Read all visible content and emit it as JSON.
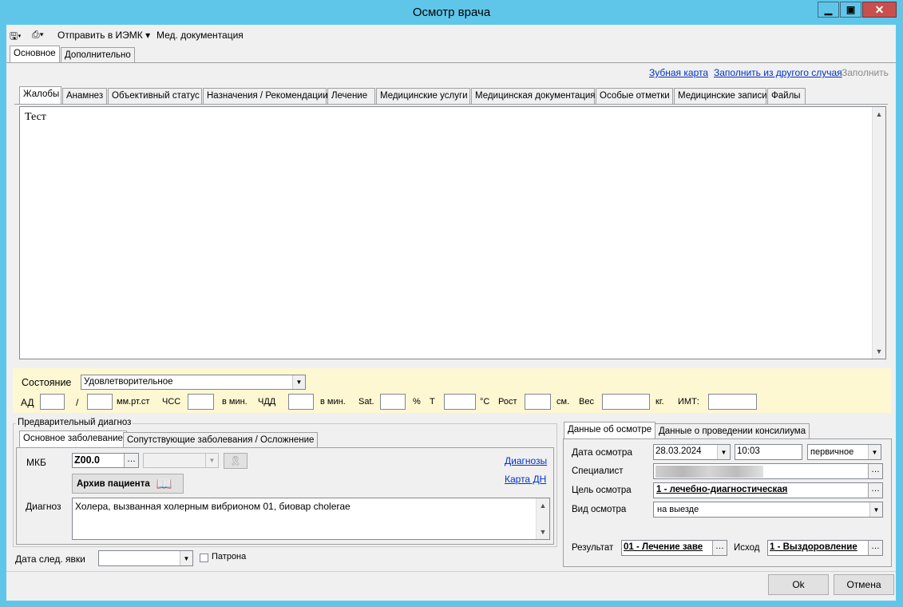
{
  "window": {
    "title": "Осмотр врача"
  },
  "toolbar": {
    "send": "Отправить в ИЭМК",
    "meddoc": "Мед. документация"
  },
  "main_tabs": [
    "Основное",
    "Дополнительно"
  ],
  "top_links": {
    "dental": "Зубная карта",
    "fill_other": "Заполнить из другого случая",
    "fill": "Заполнить"
  },
  "sub_tabs": [
    "Жалобы",
    "Анамнез",
    "Объективный статус",
    "Назначения / Рекомендации",
    "Лечение",
    "Медицинские услуги",
    "Медицинская документация",
    "Особые отметки",
    "Медицинские записи",
    "Файлы"
  ],
  "complaints_text": "Тест",
  "vitals": {
    "state_label": "Состояние",
    "state_value": "Удовлетворительное",
    "ad": "АД",
    "slash": "/",
    "mmhg": "мм.рт.ст",
    "hr": "ЧСС",
    "per_min": "в мин.",
    "rr": "ЧДД",
    "per_min2": "в мин.",
    "sat": "Sat.",
    "pct": "%",
    "t": "Т",
    "celsius": "°C",
    "height": "Рост",
    "cm": "см.",
    "weight": "Вес",
    "kg": "кг.",
    "bmi": "ИМТ:"
  },
  "diagnosis": {
    "group_title": "Предварительный диагноз",
    "tabs": [
      "Основное заболевание",
      "Сопутствующие заболевания / Осложнение"
    ],
    "mkb_label": "МКБ",
    "mkb_value": "Z00.0",
    "archive_button": "Архив пациента",
    "link_diagnoses": "Диагнозы",
    "link_card": "Карта ДН",
    "diag_label": "Диагноз",
    "diag_value": "Холера, вызванная холерным вибрионом 01, биовар cholerae"
  },
  "next_visit": {
    "label": "Дата след. явки",
    "patronage": "Патрона"
  },
  "exam": {
    "tabs": [
      "Данные об осмотре",
      "Данные о проведении консилиума"
    ],
    "date_label": "Дата осмотра",
    "date_value": "28.03.2024",
    "time_value": "10:03",
    "kind_value": "первичное",
    "specialist_label": "Специалист",
    "purpose_label": "Цель осмотра",
    "purpose_value": "1 - лечебно-диагностическая",
    "type_label": "Вид осмотра",
    "type_value": "на выезде",
    "result_label": "Результат",
    "result_value": "01 - Лечение заве",
    "outcome_label": "Исход",
    "outcome_value": "1 - Выздоровление"
  },
  "buttons": {
    "ok": "Ok",
    "cancel": "Отмена"
  }
}
